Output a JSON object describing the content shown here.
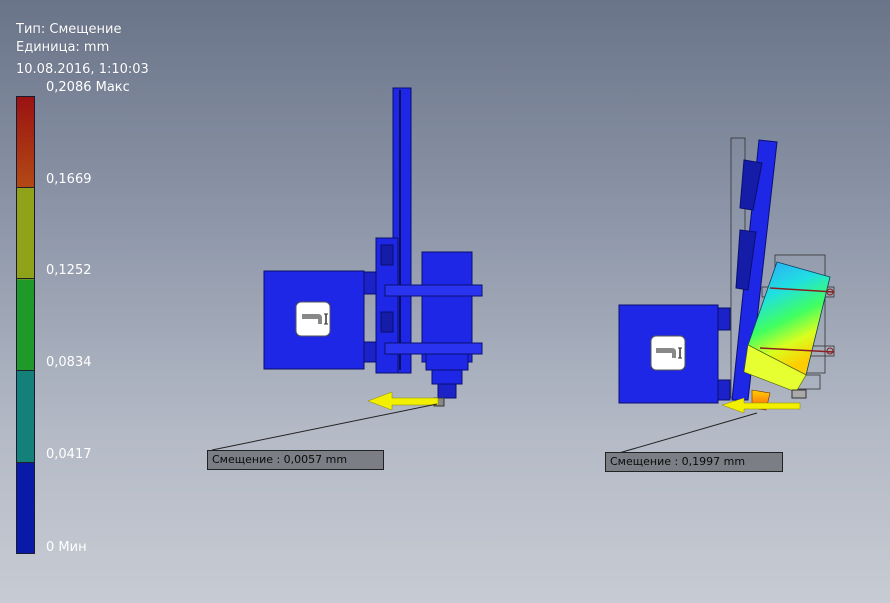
{
  "result_info": {
    "type_label": "Тип: Смещение",
    "units_label": "Единица: mm",
    "timestamp": "10.08.2016, 1:10:03"
  },
  "legend": {
    "max_label": "0,2086 Макс",
    "tick_1669": "0,1669",
    "tick_1252": "0,1252",
    "tick_0834": "0,0834",
    "tick_0417": "0,0417",
    "min_label": "0 Мин",
    "colors": [
      "#0a1aa8",
      "#14807a",
      "#1f9a2a",
      "#8fa21a",
      "#b34a14",
      "#9a1212"
    ]
  },
  "probes": {
    "left_label": "Смещение : 0,0057 mm",
    "right_label": "Смещение : 0,1997 mm"
  },
  "colors": {
    "model_blue": "#1e27e6",
    "load_arrow": "#f2f000",
    "background_top": "#6a7489",
    "background_bottom": "#c7cbd3"
  },
  "icons": [
    "load-hand-icon-left",
    "load-hand-icon-right",
    "load-arrow-left",
    "load-arrow-right"
  ]
}
